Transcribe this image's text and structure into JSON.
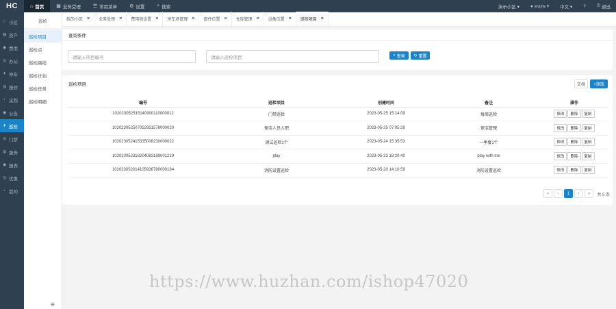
{
  "app": {
    "logo": "HC"
  },
  "topnav": [
    {
      "icon": "⌂",
      "label": "首页",
      "active": true
    },
    {
      "icon": "▦",
      "label": "业务受理"
    },
    {
      "icon": "☰",
      "label": "常用菜单"
    },
    {
      "icon": "⚙",
      "label": "设置"
    },
    {
      "icon": "⌕",
      "label": "搜索"
    }
  ],
  "topright": {
    "community": "演示小区 ▾",
    "user": "wuxw ▾",
    "lang": "中文 ▾",
    "help": "?",
    "logout": "退出"
  },
  "sidebar": [
    {
      "icon": "□",
      "label": "小区"
    },
    {
      "icon": "▤",
      "label": "资产"
    },
    {
      "icon": "◉",
      "label": "费用"
    },
    {
      "icon": "◎",
      "label": "办公"
    },
    {
      "icon": "✈",
      "label": "停车"
    },
    {
      "icon": "◍",
      "label": "报修"
    },
    {
      "icon": "◔",
      "label": "采购"
    },
    {
      "icon": "◉",
      "label": "公告"
    },
    {
      "icon": "✈",
      "label": "巡检",
      "active": true
    },
    {
      "icon": "◎",
      "label": "门禁"
    },
    {
      "icon": "◍",
      "label": "服务"
    },
    {
      "icon": "◉",
      "label": "报表"
    },
    {
      "icon": "◎",
      "label": "优惠"
    },
    {
      "icon": "◔",
      "label": "我的"
    }
  ],
  "submenu": {
    "title": "巡检",
    "items": [
      {
        "label": "巡检项目",
        "active": true
      },
      {
        "label": "巡检点"
      },
      {
        "label": "巡检路线"
      },
      {
        "label": "巡检计划"
      },
      {
        "label": "巡检任务"
      },
      {
        "label": "巡检明细"
      }
    ],
    "collapse": "☰"
  },
  "tabs": [
    {
      "label": "我的小区"
    },
    {
      "label": "业务受理"
    },
    {
      "label": "费用项设置"
    },
    {
      "label": "停车场管理"
    },
    {
      "label": "部件位置"
    },
    {
      "label": "仓库管理"
    },
    {
      "label": "设备位置"
    },
    {
      "label": "巡检项目",
      "active": true
    }
  ],
  "tab_close": "×",
  "query": {
    "title": "查询条件",
    "code_placeholder": "请输入项目编号",
    "name_placeholder": "请输入巡检项目",
    "search_label": "查询",
    "reset_label": "重置"
  },
  "list": {
    "title": "巡检项目",
    "doc_label": "文档",
    "add_label": "+添加",
    "columns": [
      "编号",
      "巡检项目",
      "创建时间",
      "备注",
      "操作"
    ],
    "rows": [
      {
        "code": "102023052515140900110000012",
        "name": "门禁巡检",
        "time": "2023-05-25 15:14:09",
        "remark": "每周巡检"
      },
      {
        "code": "102023052507052951578000020",
        "name": "保洁人员入职",
        "time": "2023-05-25 07:05:29",
        "remark": "保洁管理"
      },
      {
        "code": "102023052415335008230000022",
        "name": "测试巡检1个",
        "time": "2023-05-24 15:35:53",
        "remark": "一季度1个"
      },
      {
        "code": "102023052318204083189001219",
        "name": "play",
        "time": "2023-05-23 18:20:40",
        "remark": "play with me"
      },
      {
        "code": "102023052014105936780000184",
        "name": "消防设置巡检",
        "time": "2023-05-20 14:10:59",
        "remark": "消防设置巡检"
      }
    ],
    "op_edit": "修改",
    "op_delete": "删除",
    "op_copy": "复制",
    "pager": [
      "«",
      "‹",
      "1",
      "›",
      "»"
    ],
    "total": "共 5 条"
  },
  "watermark": "https://www.huzhan.com/ishop47020"
}
